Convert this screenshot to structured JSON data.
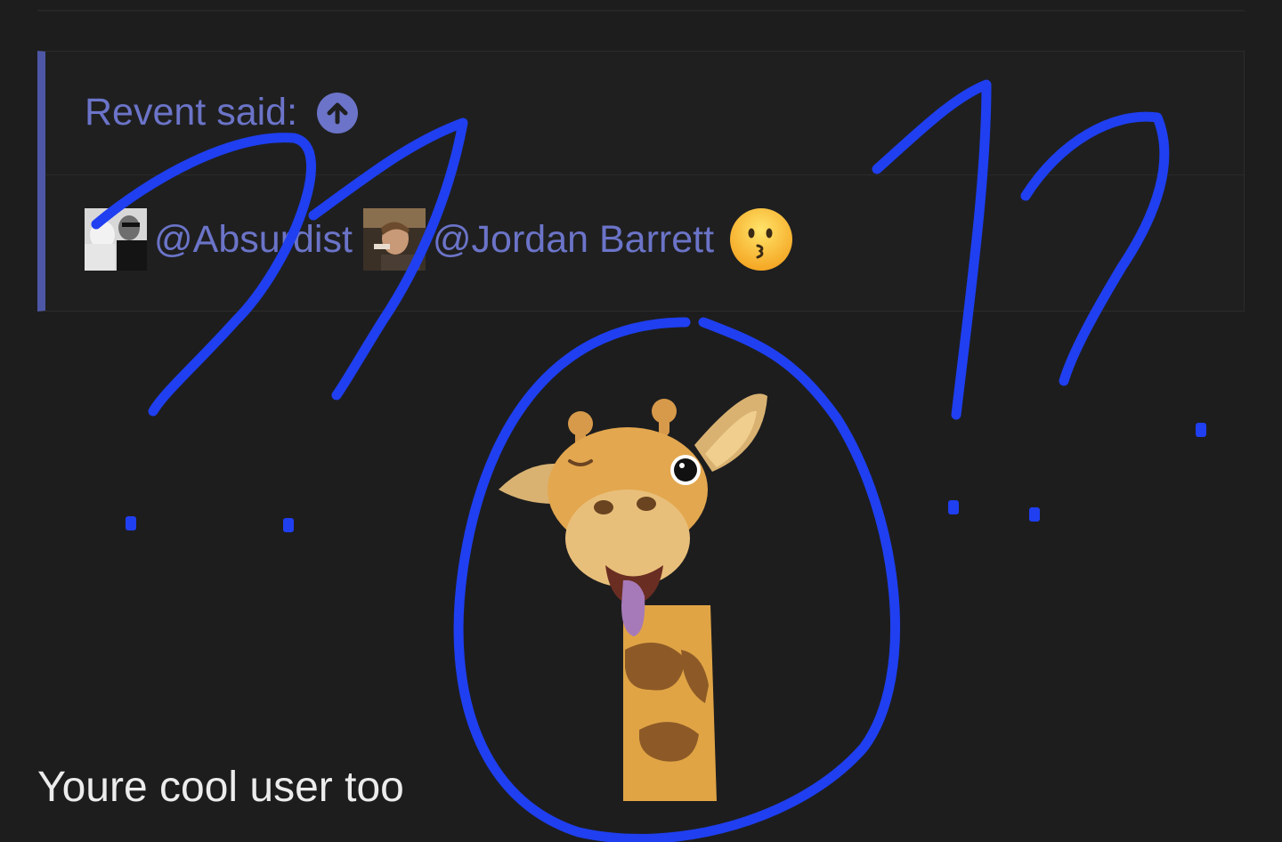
{
  "quote": {
    "author_label": "Revent said:",
    "jump_icon": "arrow-up-circle-icon",
    "mentions": [
      {
        "name": "@Absurdist",
        "avatar": "avatar-photo-bw"
      },
      {
        "name": "@Jordan Barrett",
        "avatar": "avatar-photo-smoking"
      }
    ],
    "emoji": "kissing-face-emoji"
  },
  "message": {
    "text": "Youre cool user too",
    "sticker": "giraffe-memoji-sticker"
  },
  "colors": {
    "background": "#1d1d1e",
    "quote_bar": "#4e57a6",
    "link": "#6b74c8",
    "text": "#ececec",
    "annotation": "#1f3ff0"
  }
}
